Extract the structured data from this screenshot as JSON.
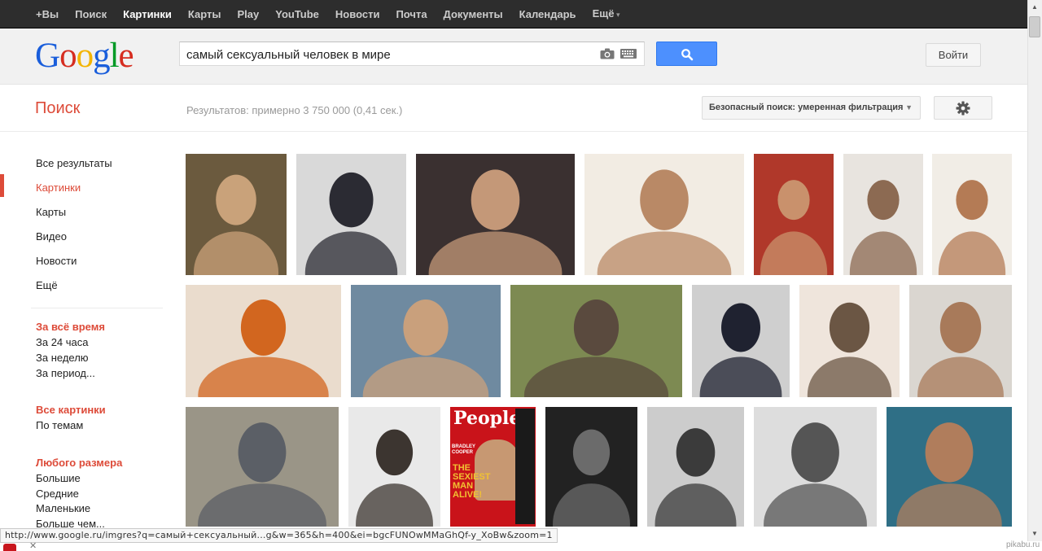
{
  "topnav": {
    "items": [
      {
        "label": "+Вы",
        "active": false
      },
      {
        "label": "Поиск",
        "active": false
      },
      {
        "label": "Картинки",
        "active": true
      },
      {
        "label": "Карты",
        "active": false
      },
      {
        "label": "Play",
        "active": false
      },
      {
        "label": "YouTube",
        "active": false
      },
      {
        "label": "Новости",
        "active": false
      },
      {
        "label": "Почта",
        "active": false
      },
      {
        "label": "Документы",
        "active": false
      },
      {
        "label": "Календарь",
        "active": false
      },
      {
        "label": "Ещё",
        "active": false
      }
    ]
  },
  "header": {
    "logo_letters": [
      {
        "char": "G",
        "color": "#1a5edb"
      },
      {
        "char": "o",
        "color": "#d62d20"
      },
      {
        "char": "o",
        "color": "#f3b400"
      },
      {
        "char": "g",
        "color": "#1a5edb"
      },
      {
        "char": "l",
        "color": "#009925"
      },
      {
        "char": "e",
        "color": "#d62d20"
      }
    ],
    "search_query": "самый сексуальный человек в мире",
    "signin_label": "Войти"
  },
  "subheader": {
    "section_title": "Поиск",
    "result_stats": "Результатов: примерно 3 750 000 (0,41 сек.)",
    "safe_search_label": "Безопасный поиск: умеренная фильтрация"
  },
  "leftnav": {
    "types": [
      {
        "label": "Все результаты",
        "active": false
      },
      {
        "label": "Картинки",
        "active": true
      },
      {
        "label": "Карты",
        "active": false
      },
      {
        "label": "Видео",
        "active": false
      },
      {
        "label": "Новости",
        "active": false
      },
      {
        "label": "Ещё",
        "active": false
      }
    ],
    "time_head": "За всё время",
    "time_items": [
      "За 24 часа",
      "За неделю",
      "За период..."
    ],
    "type_head": "Все картинки",
    "type_items": [
      "По темам"
    ],
    "size_head": "Любого размера",
    "size_items": [
      "Большие",
      "Средние",
      "Маленькие",
      "Больше чем..."
    ]
  },
  "images": {
    "row1": [
      {
        "bg": "#6b5a3e",
        "fg": "#c9a27a"
      },
      {
        "bg": "#d9d9d9",
        "fg": "#2b2b33"
      },
      {
        "bg": "#3a3030",
        "fg": "#c49878"
      },
      {
        "bg": "#f2ece3",
        "fg": "#b98966"
      },
      {
        "bg": "#b0382a",
        "fg": "#c9916c"
      },
      {
        "bg": "#e8e4df",
        "fg": "#8c6a52"
      },
      {
        "bg": "#f1ede6",
        "fg": "#b47b55"
      }
    ],
    "row2": [
      {
        "bg": "#eadccd",
        "fg": "#d2661f"
      },
      {
        "bg": "#6f8aa0",
        "fg": "#c9a07c"
      },
      {
        "bg": "#7d8a52",
        "fg": "#5a4a3e"
      },
      {
        "bg": "#cfcfcf",
        "fg": "#1f2230"
      },
      {
        "bg": "#efe5dc",
        "fg": "#6b5644"
      },
      {
        "bg": "#dad6d0",
        "fg": "#a87a5a"
      }
    ],
    "row3": [
      {
        "bg": "#9a9587",
        "fg": "#5b5f66"
      },
      {
        "bg": "#e9e9e9",
        "fg": "#3c3530"
      },
      {
        "bg": "#c9131a",
        "fg": "#f1c232"
      },
      {
        "bg": "#222222",
        "fg": "#6b6b6b"
      },
      {
        "bg": "#cccccc",
        "fg": "#3b3b3b"
      },
      {
        "bg": "#dddddd",
        "fg": "#555555"
      },
      {
        "bg": "#2f6f86",
        "fg": "#b07d5c"
      }
    ],
    "magazine_text": [
      "People",
      "BRADLEY COOPER",
      "THE SEXIEST MAN ALIVE!"
    ]
  },
  "statusbar": {
    "url": "http://www.google.ru/imgres?q=самый+сексуальный...g&w=365&h=400&ei=bgcFUNOwMMaGhQf-y_XoBw&zoom=1"
  },
  "footer": {
    "watermark": "pikabu.ru"
  }
}
